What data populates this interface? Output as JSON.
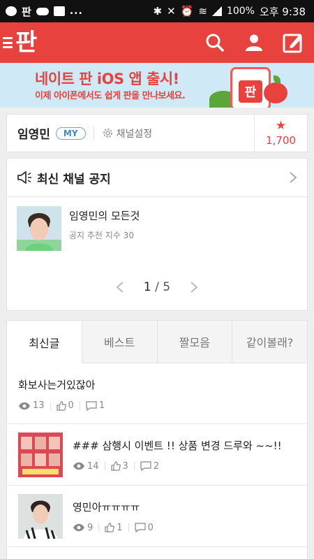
{
  "status_bar": {
    "app_label": "판",
    "dots": "...",
    "battery": "100%",
    "time": "오후 9:38"
  },
  "app_bar": {
    "logo": "판",
    "icons": [
      "menu-icon",
      "search-icon",
      "profile-icon",
      "write-icon"
    ],
    "accent_color": "#e8423f"
  },
  "banner": {
    "title": "네이트 판 iOS 앱 출시!",
    "subtitle": "이제 아이폰에서도 쉽게 판을 만나보세요.",
    "phone_label": "판"
  },
  "channel": {
    "name": "임영민",
    "badge": "MY",
    "settings_label": "채널설정",
    "score": "1,700"
  },
  "notice": {
    "header": "최신 채널 공지",
    "post_title": "임영민의 모든것",
    "post_meta": "공지 추천 지수 30",
    "page_current": "1",
    "page_sep": "/",
    "page_total": "5"
  },
  "tabs": [
    {
      "label": "최신글"
    },
    {
      "label": "베스트"
    },
    {
      "label": "짤모음"
    },
    {
      "label": "같이볼래?"
    }
  ],
  "posts": [
    {
      "title": "화보사는거있잖아",
      "views": "13",
      "likes": "0",
      "comments": "1"
    },
    {
      "title": "### 삼행시 이벤트 !! 상품 변경 드루와 ~~!!",
      "views": "14",
      "likes": "3",
      "comments": "2"
    },
    {
      "title": "영민아ㅠㅠㅠㅠ",
      "views": "9",
      "likes": "1",
      "comments": "0"
    }
  ]
}
